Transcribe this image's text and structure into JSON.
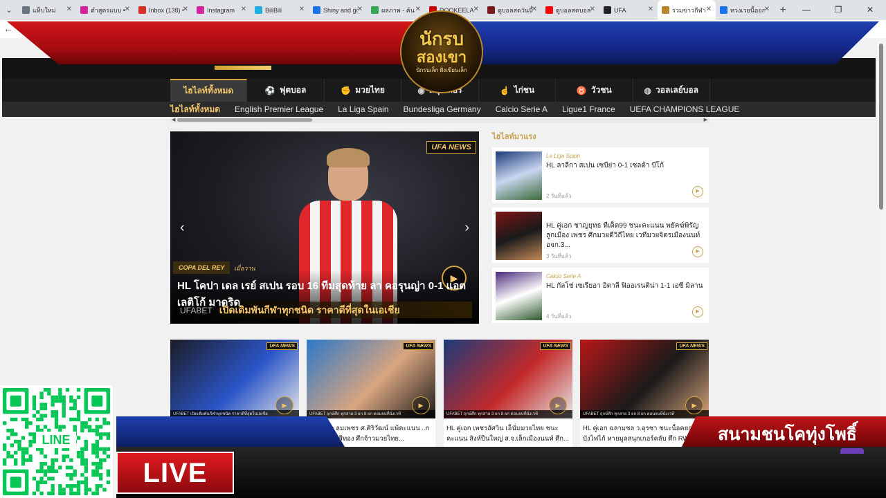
{
  "browser": {
    "tabs": [
      {
        "label": "แท็บใหม่",
        "fav": "#6b7280",
        "active": false
      },
      {
        "label": "ตำสูตรแบบ • Ins",
        "fav": "#d6249f",
        "active": false
      },
      {
        "label": "Inbox (138) •",
        "fav": "#d93025",
        "active": false
      },
      {
        "label": "Instagram",
        "fav": "#d6249f",
        "active": false
      },
      {
        "label": "BiliBili",
        "fav": "#23ade5",
        "active": false
      },
      {
        "label": "Shiny and go",
        "fav": "#1a73e8",
        "active": false
      },
      {
        "label": "ผลภาพ - ค้น",
        "fav": "#34a853",
        "active": false
      },
      {
        "label": "DOOKEELA",
        "fav": "#c00",
        "active": false
      },
      {
        "label": "ดูบอลสดวันนี้ ดี",
        "fav": "#7a1a1a",
        "active": false
      },
      {
        "label": "ดูบอลสดบอลดี",
        "fav": "#ff0000",
        "active": false
      },
      {
        "label": "UFA",
        "fav": "#222222",
        "active": false
      },
      {
        "label": "รวมข่าวกีฬา ดู",
        "fav": "#b8862b",
        "active": true
      },
      {
        "label": "ทวงเวยนี้ออกกี",
        "fav": "#1a73e8",
        "active": false
      }
    ],
    "new_tab": "+",
    "window_controls": [
      "—",
      "❐",
      "✕"
    ],
    "back": "←"
  },
  "banner": {
    "logo_line1": "นักรบ",
    "logo_line2": "สองเขา",
    "logo_tagline": "นักรบเล็ก ฝั่งเขียนเล็ก"
  },
  "nav": {
    "items": [
      {
        "label": "ไฮไลท์ทั้งหมด",
        "icon": "",
        "active": true
      },
      {
        "label": "ฟุตบอล",
        "icon": "⚽",
        "active": false
      },
      {
        "label": "มวยไทย",
        "icon": "✊",
        "active": false
      },
      {
        "label": "สนุกเกอร์",
        "icon": "◉",
        "active": false
      },
      {
        "label": "ไก่ชน",
        "icon": "☝",
        "active": false
      },
      {
        "label": "วัวชน",
        "icon": "♉",
        "active": false
      },
      {
        "label": "วอลเลย์บอล",
        "icon": "◍",
        "active": false
      }
    ],
    "subitems": [
      {
        "label": "ไฮไลท์ทั้งหมด",
        "active": true
      },
      {
        "label": "English Premier League",
        "active": false
      },
      {
        "label": "La Liga Spain",
        "active": false
      },
      {
        "label": "Bundesliga Germany",
        "active": false
      },
      {
        "label": "Calcio Serie A",
        "active": false
      },
      {
        "label": "Ligue1 France",
        "active": false
      },
      {
        "label": "UEFA CHAMPIONS LEAGUE",
        "active": false
      }
    ]
  },
  "hero": {
    "badge": "UFA NEWS",
    "tag": "COPA DEL REY",
    "time": "เมื่อวาน",
    "title": "HL โคปา เดล เรย์ สเปน รอบ 16 ทีมสุดท้าย ลา คอรุนญ่า 0-1 แอต เลติโก้ มาดริด",
    "promo_brand": "UFABET",
    "promo_text": "เปิดเดิมพันกีฬาทุกชนิด ราคาดีที่สุดในเอเชีย",
    "prev": "‹",
    "next": "›",
    "play": "▶"
  },
  "highlights": {
    "heading": "ไฮไลท์มาแรง",
    "items": [
      {
        "league": "La Liga Spain",
        "title": "HL ลาลีกา สเปน เซบีย่า 0-1 เซลต้า บีโก้",
        "ago": "2 วันที่แล้ว",
        "colors": [
          "#1b3a7a",
          "#c9d6ef",
          "#3b6b3b"
        ]
      },
      {
        "league": "",
        "title": "HL คู่เอก ชาญยุทธ ทีเด็ด99 ชนะคะแนน พยัคฆ์พิรัญ ลูกเมือง เพชร ศึกมวยดีวิถีไทย เวทีมวยจิตรเมืองนนท์ อจก.3...",
        "ago": "3 วันที่แล้ว",
        "colors": [
          "#7a1414",
          "#1a1a1a",
          "#c48a5a"
        ]
      },
      {
        "league": "Calcio Serie A",
        "title": "HL กัลโช่ เซเรียอา อิตาลี ฟิออเรนติน่า 1-1 เอซี มิลาน",
        "ago": "4 วันที่แล้ว",
        "colors": [
          "#4a2a7a",
          "#ffffff",
          "#2d5a2d"
        ]
      }
    ],
    "play": "▶"
  },
  "cards": [
    {
      "title": "",
      "strip": "UFABET  เปิดเดิมพันกีฬาทุกชนิด ราคาดีที่สุดในเอเชีย",
      "colors": [
        "#1c1c26",
        "#2a55c8",
        "#e8e8e8"
      ]
    },
    {
      "title": "HL คู่เอก ลมเพชร ศ.ศิริวัฒน์ แพ้คะแนน ..ก เพ็ชรเพชรสีทอง ศึกจ้าวมวยไทย...",
      "strip": "UFABET  ฤกษ์ศึก ทุกสาย 3 ยก 8 ยก ตอนจบที่นั่งเวที",
      "colors": [
        "#2d78c8",
        "#d9a57f",
        "#1a1a1a"
      ]
    },
    {
      "title": "HL คู่เอก เพชรอัศวิน เอ็นั่มมวยไทย ชนะ คะแนน สิงห์ปืนใหญ่ ส.จ.เล็กเมืองนนท์ ศึก...",
      "strip": "UFABET  ฤกษ์ศึก ทุกสาย 3 ยก 8 ยก ตอนจบที่นั่งเวที",
      "colors": [
        "#1b3b7a",
        "#c42a2a",
        "#e6e6e6"
      ]
    },
    {
      "title": "HL คู่เอก ฉลามชล ว.อุรชา ชนะน็อคยกแรก บังไฟไก้ หายมูลสนุกเกอร์คลับ ศึก RWS...",
      "strip": "UFABET  ฤกษ์ศึก ทุกสาย 3 ยก 8 ยก ตอนจบที่นั่งเวที",
      "colors": [
        "#b81818",
        "#1a1a1a",
        "#d8a47c"
      ]
    }
  ],
  "broadcast": {
    "live_label": "LIVE",
    "station": "สนามชนโคทุ่งโพธิ์",
    "qr_label": "LINE"
  }
}
